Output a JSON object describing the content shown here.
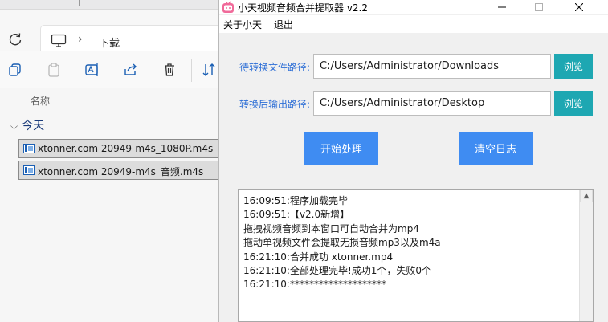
{
  "explorer": {
    "address_path": "下载",
    "column_header": "名称",
    "group_label": "今天",
    "files": [
      {
        "name": "xtonner.com 20949-m4s_1080P.m4s"
      },
      {
        "name": "xtonner.com 20949-m4s_音频.m4s"
      }
    ],
    "toolbar_icons": [
      "copy-icon",
      "paste-icon",
      "rename-icon",
      "share-icon",
      "delete-icon",
      "sort-icon"
    ]
  },
  "app": {
    "title": "小天视频音频合并提取器 v2.2",
    "menu": [
      "关于小天",
      "退出"
    ],
    "input_label": "待转换文件路径:",
    "input_path": "C:/Users/Administrator/Downloads",
    "output_label": "转换后输出路径:",
    "output_path": "C:/Users/Administrator/Desktop",
    "browse_label": "浏览",
    "start_label": "开始处理",
    "clear_label": "清空日志",
    "log": [
      "16:09:51:程序加载完毕",
      "16:09:51:【v2.0新增】",
      "拖拽视频音频到本窗口可自动合并为mp4",
      "拖动单视频文件会提取无损音频mp3以及m4a",
      "16:21:10:合并成功 xtonner.mp4",
      "16:21:10:全部处理完毕!成功1个，失败0个",
      "16:21:10:********************"
    ],
    "colors": {
      "accent_blue": "#3f8cf2",
      "browse_teal": "#1ea7b2",
      "label_blue": "#2e6fd6"
    }
  }
}
